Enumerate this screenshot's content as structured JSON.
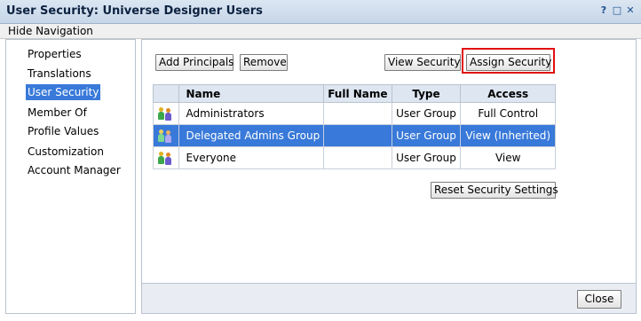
{
  "window": {
    "title": "User Security: Universe Designer Users",
    "controls": [
      "?",
      "□",
      "✕"
    ]
  },
  "nav_toggle": "Hide Navigation",
  "sidebar": {
    "items": [
      {
        "label": "Properties"
      },
      {
        "label": "Translations"
      },
      {
        "label": "User Security",
        "selected": true
      },
      {
        "label": "Member Of"
      },
      {
        "label": "Profile Values"
      },
      {
        "label": "Customization"
      },
      {
        "label": "Account Manager"
      }
    ]
  },
  "toolbar": {
    "add_principals": "Add Principals",
    "remove": "Remove",
    "view_security": "View Security",
    "assign_security": "Assign Security"
  },
  "table": {
    "headers": {
      "name": "Name",
      "full_name": "Full Name",
      "type": "Type",
      "access": "Access"
    },
    "rows": [
      {
        "icon": "user-group-icon",
        "name": "Administrators",
        "full_name": "",
        "type": "User Group",
        "access": "Full Control",
        "selected": false
      },
      {
        "icon": "user-group-icon",
        "name": "Delegated Admins Group",
        "full_name": "",
        "type": "User Group",
        "access": "View (Inherited)",
        "selected": true
      },
      {
        "icon": "user-group-icon",
        "name": "Everyone",
        "full_name": "",
        "type": "User Group",
        "access": "View",
        "selected": false
      }
    ]
  },
  "reset_button": "Reset Security Settings",
  "close_button": "Close",
  "colors": {
    "selection": "#3879d9",
    "highlight_box": "#e01010",
    "header_bg": "#dde6f1"
  }
}
